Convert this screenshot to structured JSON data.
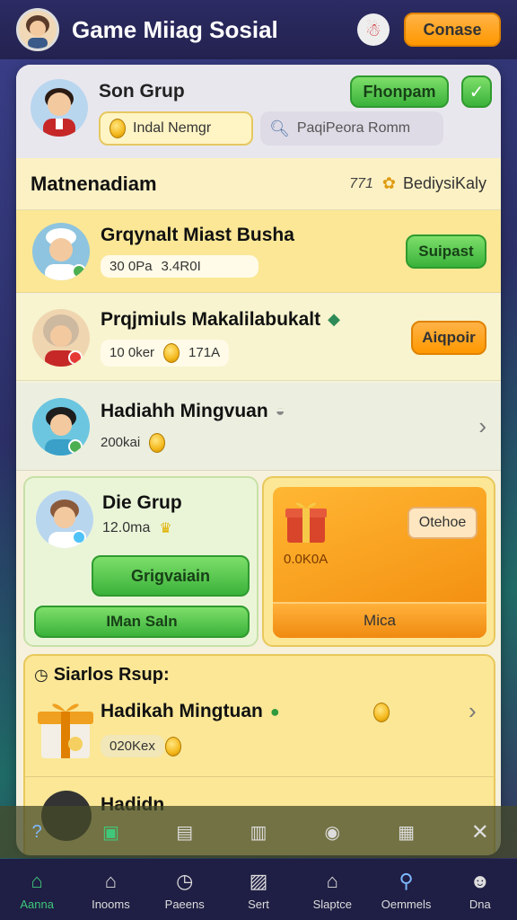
{
  "app": {
    "title": "Game Miiag Sosial",
    "top_button": "Conase"
  },
  "group": {
    "name": "Son Grup",
    "join_button": "Fhonpam",
    "input_value": "Indal Nemgr",
    "search_placeholder": "PaqiPeora Romm"
  },
  "section1": {
    "title": "Matnenadiam",
    "meta_number": "771",
    "meta_label": "BediysiKaly"
  },
  "rows": [
    {
      "title": "Grqynalt Miast Busha",
      "stat1": "30 0Pa",
      "stat2": "3.4R0I",
      "button": "Suipast"
    },
    {
      "title": "Prqjmiuls Makalilabukalt",
      "stat1": "10 0ker",
      "stat2": "171A",
      "button": "Aiqpoir"
    },
    {
      "title": "Hadiahh Mingvuan",
      "stat1": "200kai"
    }
  ],
  "card_left": {
    "title": "Die Grup",
    "value": "12.0ma",
    "button1": "Grigvaiain",
    "button2": "IMan Saln"
  },
  "card_right": {
    "badge": "Otehoe",
    "value": "0.0K0A",
    "button": "Mica"
  },
  "section2": {
    "title": "Siarlos Rsup:",
    "row_title": "Hadikah Mingtuan",
    "row_value": "020Kex",
    "next_title": "Hadidn"
  },
  "nav": [
    {
      "label": "Aanna",
      "icon": "home-icon"
    },
    {
      "label": "Inooms",
      "icon": "house-icon"
    },
    {
      "label": "Paeens",
      "icon": "clock-icon"
    },
    {
      "label": "Sert",
      "icon": "box-icon"
    },
    {
      "label": "Slaptce",
      "icon": "shop-icon"
    },
    {
      "label": "Oemmels",
      "icon": "search-people-icon"
    },
    {
      "label": "Dna",
      "icon": "person-icon"
    }
  ],
  "colors": {
    "accent_green": "#3ab23a",
    "accent_orange": "#ff9800",
    "nav_bg": "#1f1e44"
  }
}
